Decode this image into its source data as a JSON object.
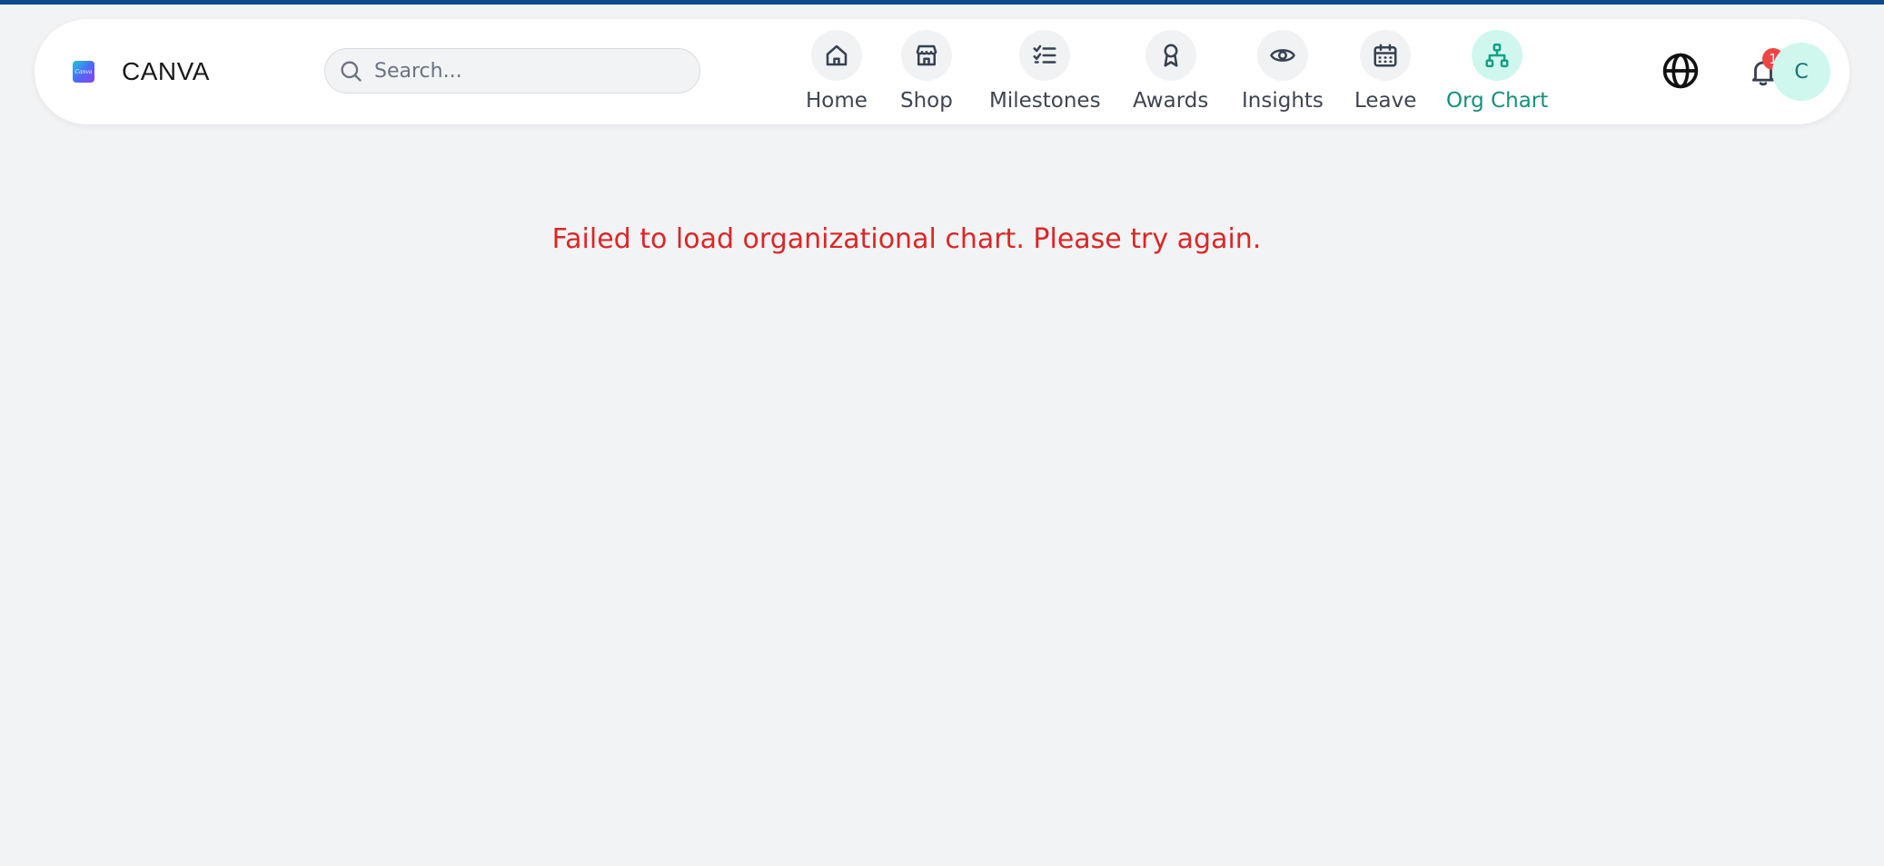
{
  "brand": {
    "logo_text": "Canva",
    "name": "CANVA"
  },
  "search": {
    "placeholder": "Search..."
  },
  "nav": {
    "items": [
      {
        "label": "Home",
        "icon": "home-icon"
      },
      {
        "label": "Shop",
        "icon": "store-icon"
      },
      {
        "label": "Milestones",
        "icon": "checklist-icon"
      },
      {
        "label": "Awards",
        "icon": "award-icon"
      },
      {
        "label": "Insights",
        "icon": "eye-icon"
      },
      {
        "label": "Leave",
        "icon": "calendar-icon"
      },
      {
        "label": "Org Chart",
        "icon": "org-chart-icon",
        "active": true
      }
    ]
  },
  "header_actions": {
    "language_icon": "globe-icon",
    "notification_icon": "bell-icon",
    "notification_count": "1",
    "avatar_initial": "C"
  },
  "main": {
    "error_text": "Failed to load organizational chart. Please try again."
  },
  "colors": {
    "accent": "#16907a",
    "error": "#dc2626",
    "top_border": "#0d4a8c",
    "badge": "#ef4444"
  }
}
